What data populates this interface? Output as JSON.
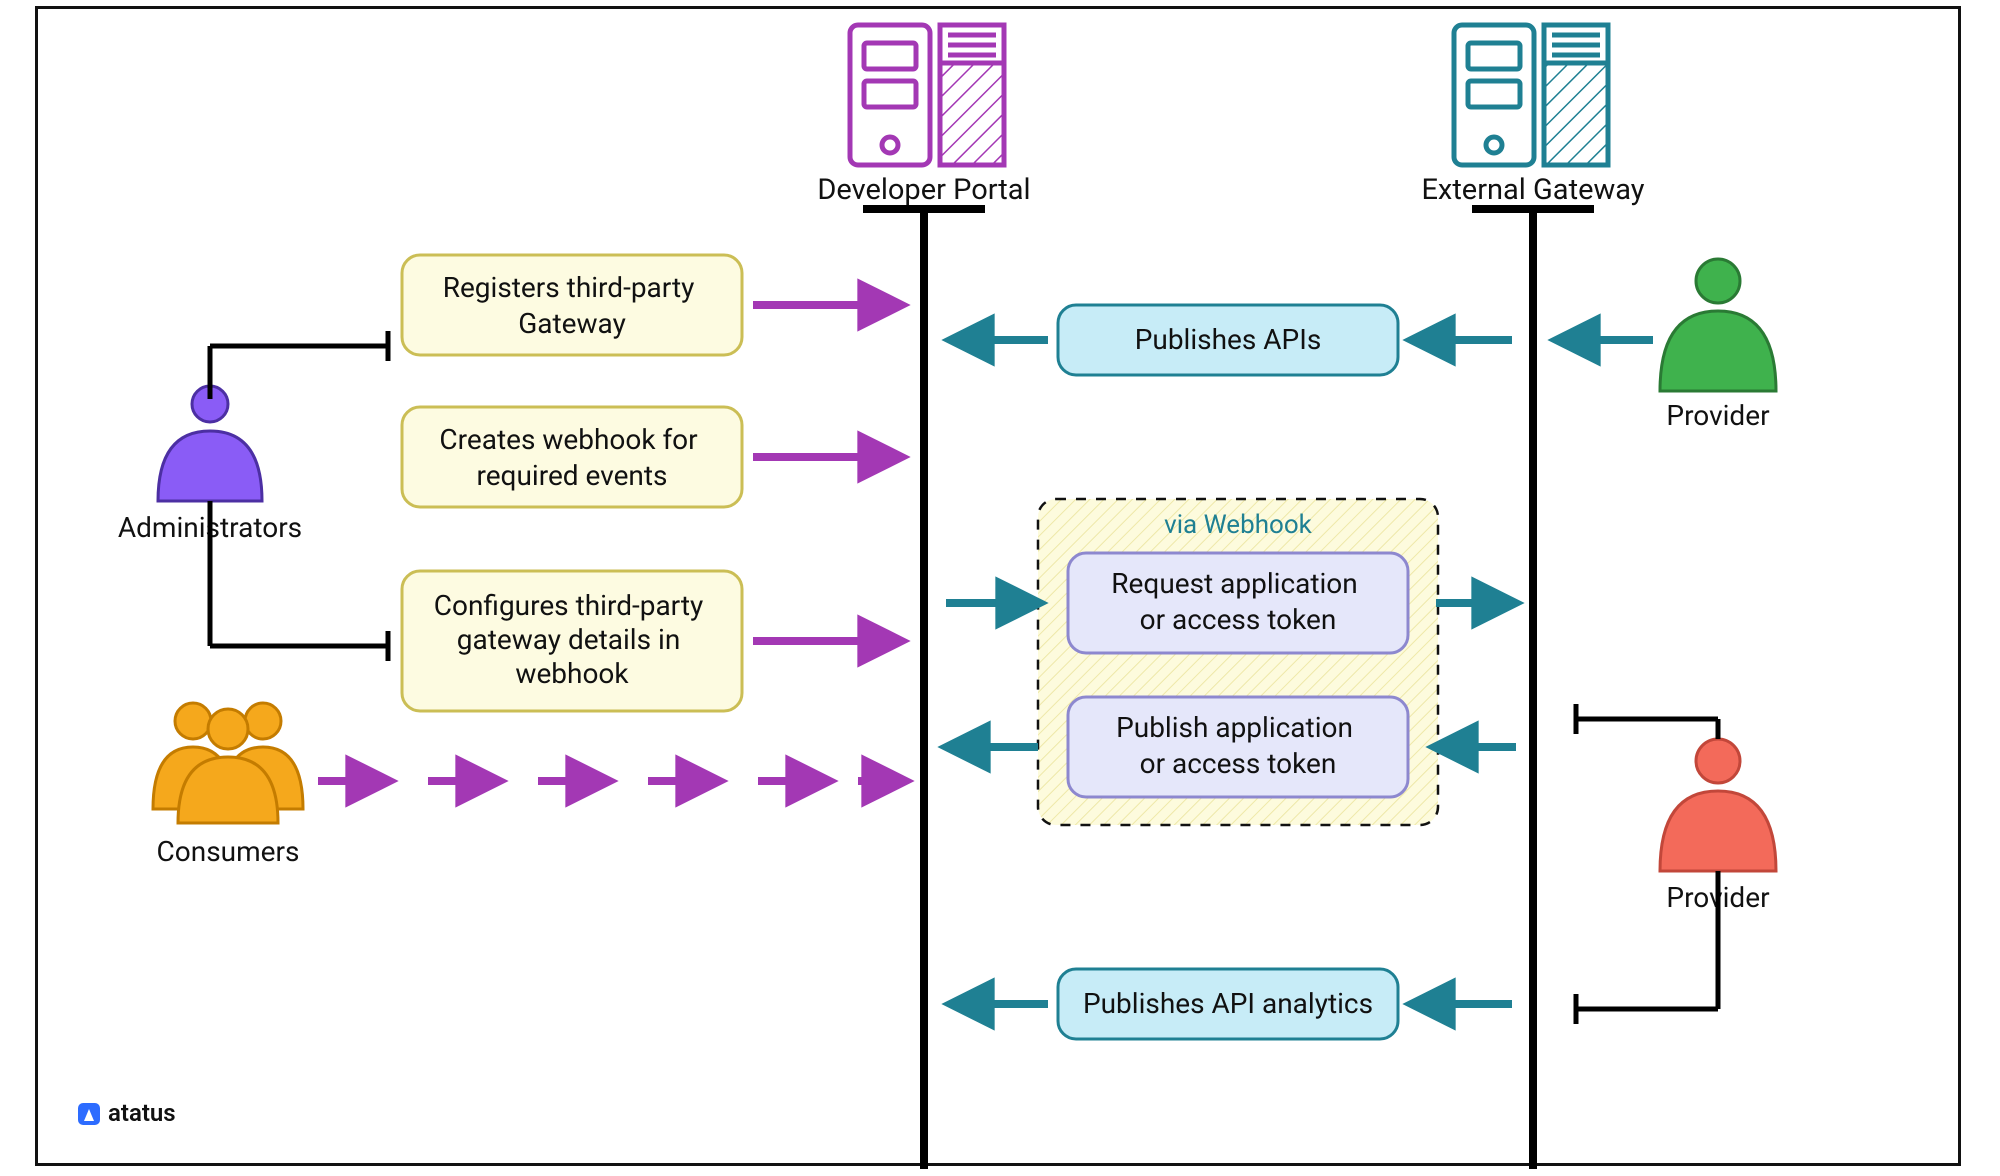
{
  "colors": {
    "purple": "#a338b4",
    "teal": "#1f8093",
    "green": "#3fb24d",
    "red": "#f36a5a",
    "orange": "#f5a81c",
    "violet": "#8a5cf6",
    "yellowFill": "#FDFBE1",
    "yellowStroke": "#CBBE55",
    "cyanFill": "#C7ECF7",
    "violetFill": "#E5E7FA"
  },
  "lifelines": {
    "devPortal": "Developer Portal",
    "extGateway": "External Gateway"
  },
  "actors": {
    "admin": "Administrators",
    "consumers": "Consumers",
    "providerTop": "Provider",
    "providerBottom": "Provider"
  },
  "steps": {
    "admin1": "Registers third-party Gateway",
    "admin2": "Creates webhook for required events",
    "admin3": "Configures third-party gateway details in webhook",
    "publishApis": "Publishes APIs",
    "viaWebhook": "via Webhook",
    "reqToken": "Request application or access token",
    "pubToken": "Publish application or access token",
    "pubAnalytics": "Publishes API analytics"
  },
  "branding": "atatus"
}
